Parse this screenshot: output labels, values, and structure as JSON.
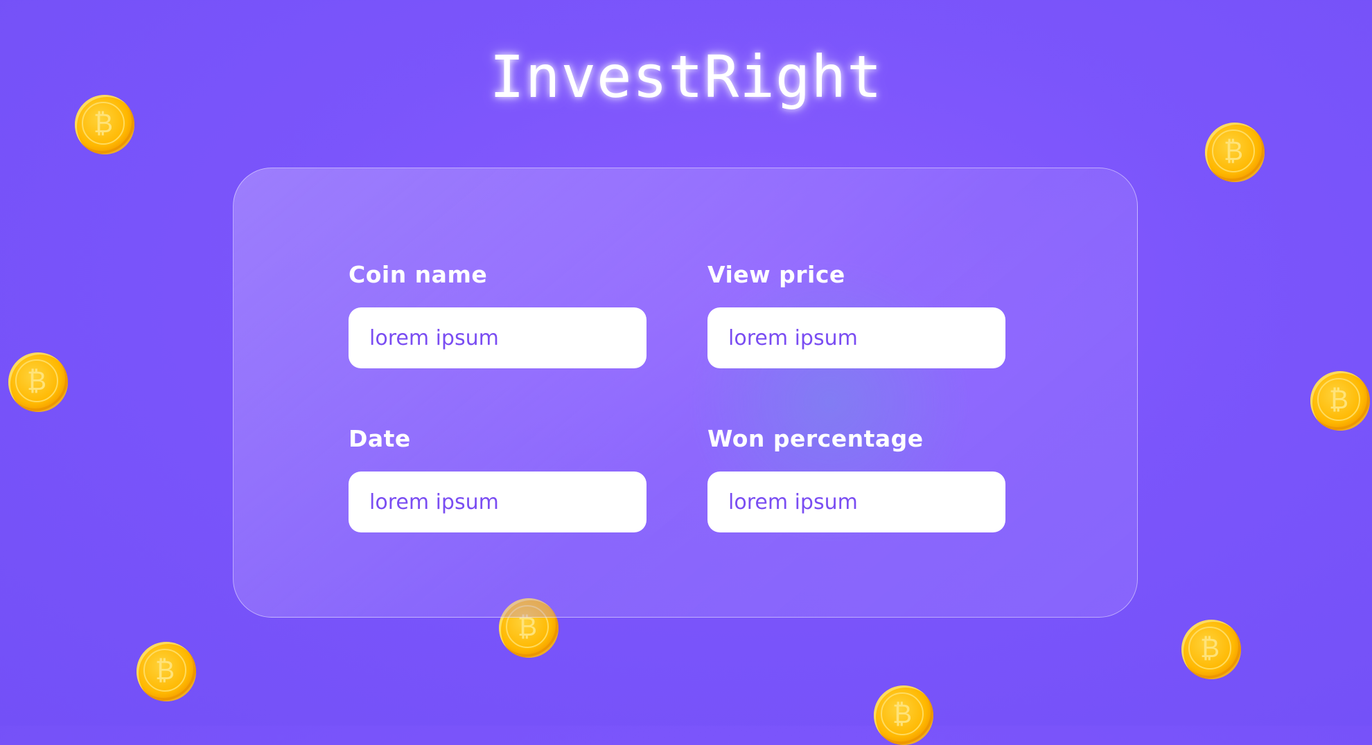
{
  "brand": {
    "logo_text": "InvestRight"
  },
  "form": {
    "coin_name": {
      "label": "Coin name",
      "placeholder": "lorem ipsum"
    },
    "view_price": {
      "label": "View price",
      "placeholder": "lorem ipsum"
    },
    "date": {
      "label": "Date",
      "placeholder": "lorem ipsum"
    },
    "won_percentage": {
      "label": "Won percentage",
      "placeholder": "lorem ipsum"
    }
  },
  "decorations": {
    "coin_icon": "bitcoin-icon",
    "coin_color": "#ffb800"
  },
  "colors": {
    "background": "#7b55fb",
    "input_text": "#7a4df2",
    "label_text": "#ffffff"
  }
}
